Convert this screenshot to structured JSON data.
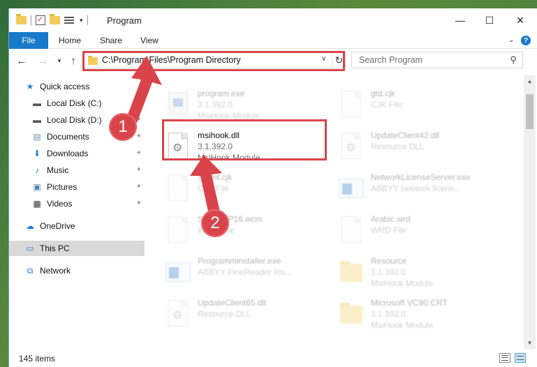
{
  "window": {
    "title": "Program",
    "controls": {
      "minimize": "—",
      "maximize": "☐",
      "close": "✕"
    }
  },
  "ribbon": {
    "tabs": [
      "File",
      "Home",
      "Share",
      "View"
    ],
    "help": "?"
  },
  "navbar": {
    "address": "C:\\Program Files\\Program Directory",
    "search_placeholder": "Search Program"
  },
  "sidebar": {
    "items": [
      {
        "label": "Quick access",
        "icon": "star-icon",
        "pinned": false
      },
      {
        "label": "Local Disk (C:)",
        "icon": "drive-icon",
        "pinned": true
      },
      {
        "label": "Local Disk (D:)",
        "icon": "drive-icon",
        "pinned": true
      },
      {
        "label": "Documents",
        "icon": "documents-icon",
        "pinned": true
      },
      {
        "label": "Downloads",
        "icon": "download-icon",
        "pinned": true
      },
      {
        "label": "Music",
        "icon": "music-icon",
        "pinned": true
      },
      {
        "label": "Pictures",
        "icon": "pictures-icon",
        "pinned": true
      },
      {
        "label": "Videos",
        "icon": "videos-icon",
        "pinned": true
      },
      {
        "label": "OneDrive",
        "icon": "cloud-icon",
        "pinned": false
      },
      {
        "label": "This PC",
        "icon": "computer-icon",
        "pinned": false,
        "selected": true
      },
      {
        "label": "Network",
        "icon": "network-icon",
        "pinned": false
      }
    ]
  },
  "files": [
    {
      "name": "program.exe",
      "line2": "3.1.392.0",
      "line3": "MsiHook Module",
      "icon": "exe-icon",
      "faded": true
    },
    {
      "name": "gtd.cjk",
      "line2": "CJK File",
      "line3": "",
      "icon": "file-icon",
      "faded": true
    },
    {
      "name": "msihook.dll",
      "line2": "3.1.392.0",
      "line3": "MsiHook Module",
      "icon": "dll-icon",
      "faded": false
    },
    {
      "name": "UpdateClient42.dll",
      "line2": "Resource DLL",
      "line3": "",
      "icon": "dll-icon",
      "faded": true
    },
    {
      "name": "Sprint.cjk",
      "line2": "CJK File",
      "line3": "",
      "icon": "file-icon",
      "faded": true
    },
    {
      "name": "NetworkLicenseServer.exe",
      "line2": "ABBYY network licens...",
      "line3": "",
      "icon": "app-icon",
      "faded": true
    },
    {
      "name": "SmartWP16.wcm",
      "line2": "WCM File",
      "line3": "",
      "icon": "file-icon",
      "faded": true
    },
    {
      "name": "Arabic.wrd",
      "line2": "WRD File",
      "line3": "",
      "icon": "file-icon",
      "faded": true
    },
    {
      "name": "Programminstaller.exe",
      "line2": "ABBYY FineReader Ins...",
      "line3": "",
      "icon": "app-icon",
      "faded": true
    },
    {
      "name": "Resource",
      "line2": "3.1.392.0",
      "line3": "MsiHook Module",
      "icon": "folder-icon",
      "faded": true
    },
    {
      "name": "UpdateClient65.dll",
      "line2": "Resource DLL",
      "line3": "",
      "icon": "dll-icon",
      "faded": true
    },
    {
      "name": "Microsoft.VC90.CRT",
      "line2": "3.1.392.0",
      "line3": "MsiHook Module",
      "icon": "folder-icon",
      "faded": true
    }
  ],
  "status": {
    "item_count": "145 items"
  },
  "annotations": {
    "step1": "1",
    "step2": "2",
    "color": "#d9444a"
  }
}
